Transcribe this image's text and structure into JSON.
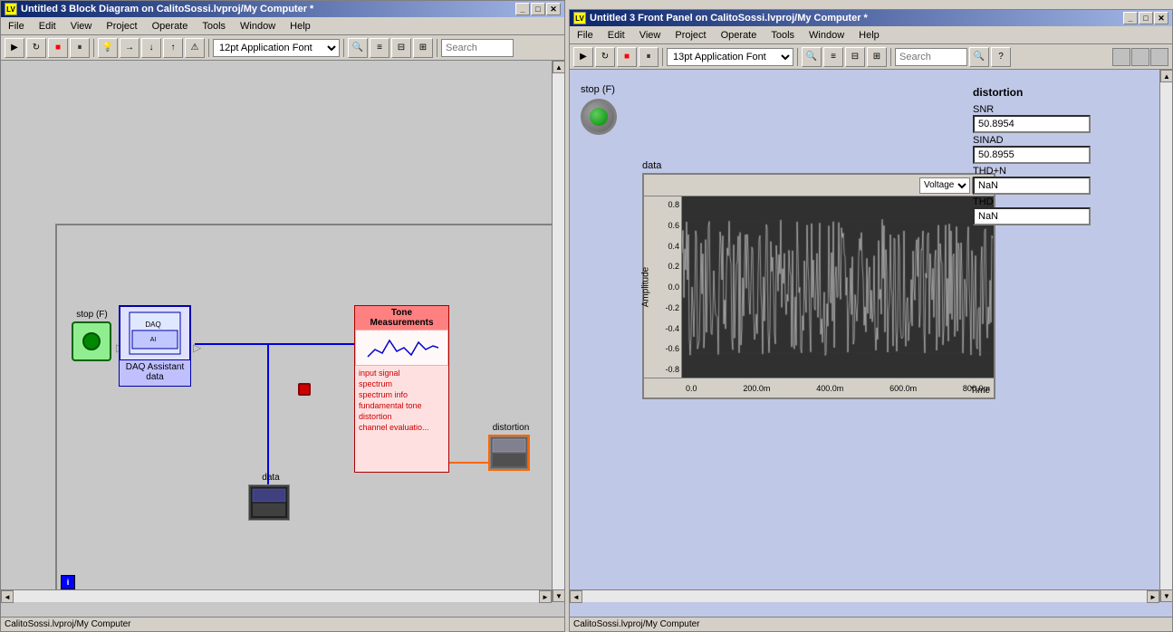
{
  "blockDiagram": {
    "title": "Untitled 3 Block Diagram on CalitoSossi.lvproj/My Computer *",
    "menus": [
      "File",
      "Edit",
      "View",
      "Project",
      "Operate",
      "Tools",
      "Window",
      "Help"
    ],
    "font": "12pt Application Font",
    "stopLabel": "stop (F)",
    "daqLabel": "DAQ Assistant",
    "daqPortLabel": "data",
    "dataLabel": "data",
    "toneTitle": "Tone",
    "toneMeasurements": "Measurements",
    "tonePorts": {
      "inputs": [
        "input signal",
        "spectrum",
        "spectrum info",
        "fundamental tone",
        "distortion",
        "channel evaluatio..."
      ],
      "outputs": []
    },
    "distortionLabel": "distortion",
    "statusbar": "CalitoSossi.lvproj/My Computer"
  },
  "frontPanel": {
    "title": "Untitled 3 Front Panel on CalitoSossi.lvproj/My Computer *",
    "menus": [
      "File",
      "Edit",
      "View",
      "Project",
      "Operate",
      "Tools",
      "Window",
      "Help"
    ],
    "font": "13pt Application Font",
    "stopLabel": "stop (F)",
    "chartLabel": "data",
    "chartMode": "Voltage",
    "yAxisValues": [
      "0.8",
      "0.6",
      "0.4",
      "0.2",
      "0.0",
      "-0.2",
      "-0.4",
      "-0.6",
      "-0.8"
    ],
    "xAxisValues": [
      "0.0",
      "200.0m",
      "400.0m",
      "600.0m",
      "800.0m"
    ],
    "yAxisTitle": "Amplitude",
    "xAxisTitle": "Time",
    "distortionPanel": {
      "title": "distortion",
      "snrLabel": "SNR",
      "snrValue": "50.8954",
      "sinadLabel": "SINAD",
      "sinadValue": "50.8955",
      "thdnLabel": "THD+N",
      "thdnValue": "NaN",
      "thdLabel": "THD",
      "thdValue": "NaN"
    },
    "statusbar": "CalitoSossi.lvproj/My Computer"
  },
  "icons": {
    "lv": "LV",
    "run": "▶",
    "pause": "⏸",
    "stop": "⏹",
    "abort": "✖",
    "undo": "↩",
    "redo": "↪",
    "scrollUp": "▲",
    "scrollDown": "▼",
    "scrollLeft": "◄",
    "scrollRight": "►",
    "minimize": "_",
    "maximize": "□",
    "close": "✕",
    "chevronDown": "▼",
    "search": "🔍"
  }
}
